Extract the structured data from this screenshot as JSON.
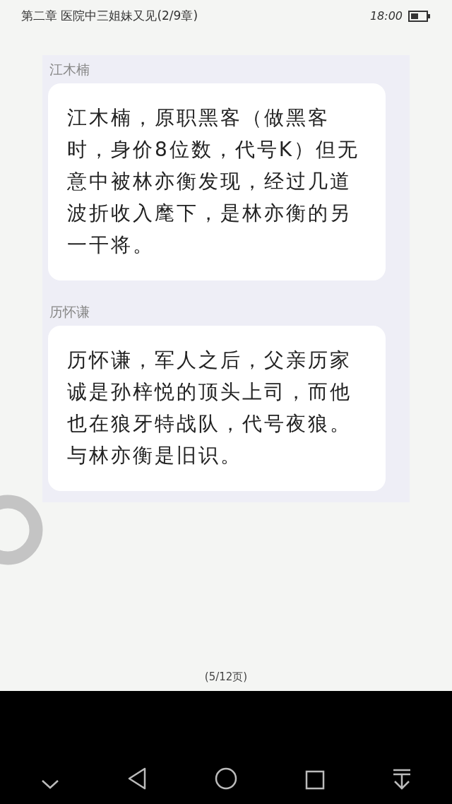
{
  "status_bar": {
    "chapter_title": "第二章 医院中三姐妹又见(2/9章)",
    "time": "18:00"
  },
  "messages": [
    {
      "sender": "江木楠",
      "text": "江木楠，原职黑客（做黑客时，身价8位数，代号K）但无意中被林亦衡发现，经过几道波折收入麾下，是林亦衡的另一干将。"
    },
    {
      "sender": "历怀谦",
      "text": "历怀谦，军人之后，父亲历家诚是孙梓悦的顶头上司，而他也在狼牙特战队，代号夜狼。与林亦衡是旧识。"
    }
  ],
  "page_indicator": "(5/12页)"
}
